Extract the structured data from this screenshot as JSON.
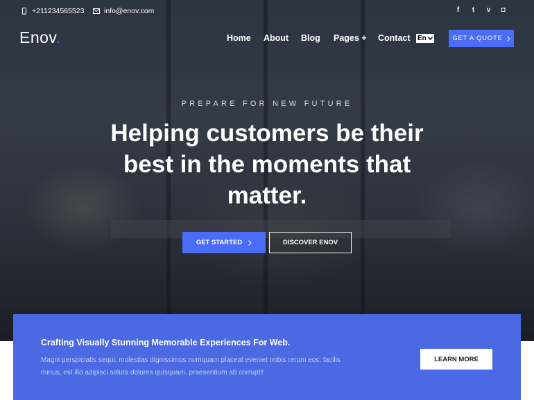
{
  "topbar": {
    "phone": "+211234565523",
    "email": "info@enov.com",
    "social": [
      {
        "icon": "facebook-icon",
        "glyph": "f"
      },
      {
        "icon": "twitter-icon",
        "glyph": "t"
      },
      {
        "icon": "vimeo-icon",
        "glyph": "v"
      },
      {
        "icon": "instagram-icon",
        "glyph": "◘"
      }
    ]
  },
  "header": {
    "logo": "Enov",
    "logo_dot": ".",
    "nav": [
      "Home",
      "About",
      "Blog",
      "Pages +",
      "Contact"
    ],
    "language": "En",
    "quote_button": "GET A QUOTE"
  },
  "hero": {
    "eyebrow": "PREPARE FOR NEW FUTURE",
    "headline": "Helping customers be their best in the moments that matter.",
    "primary_button": "GET STARTED",
    "secondary_button": "DISCOVER ENOV"
  },
  "cta": {
    "title": "Crafting Visually Stunning Memorable Experiences For Web.",
    "text": "Magni perspiciatis sequi, molestias dignissimos numquam placeat eveniet nobis rerum eos, facilis minus, est illo adipisci soluta dolores quisquam, praesentium ab corrupti!",
    "button": "LEARN MORE"
  },
  "colors": {
    "accent": "#4a6cf7",
    "cta_background": "#4a69e2"
  }
}
